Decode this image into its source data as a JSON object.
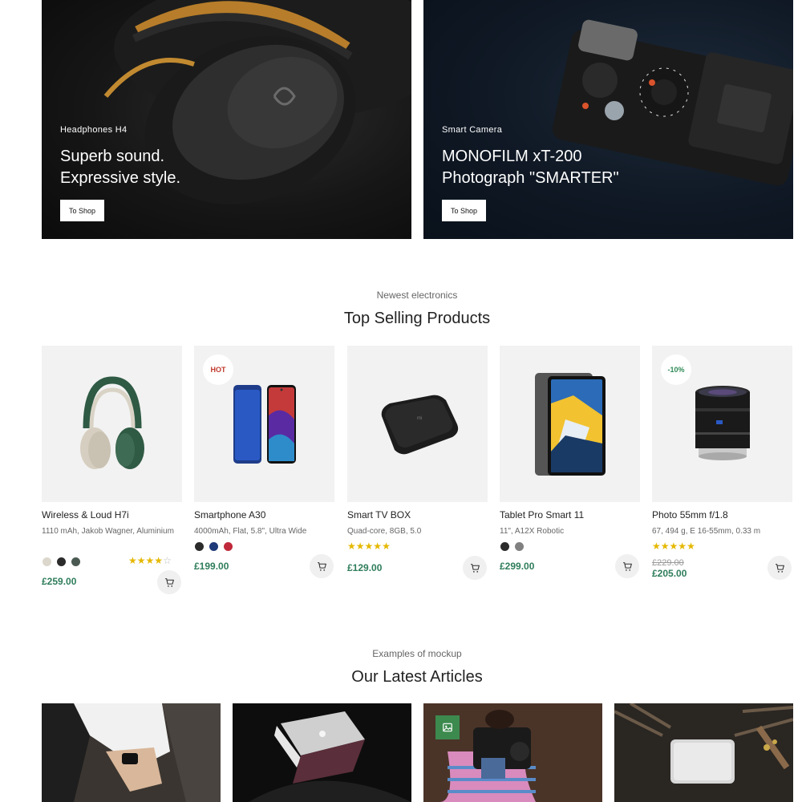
{
  "banners": [
    {
      "subtitle": "Headphones H4",
      "title_line1": "Superb sound.",
      "title_line2": "Expressive style.",
      "button": "To Shop"
    },
    {
      "subtitle": "Smart Camera",
      "title_line1": "MONOFILM xT-200",
      "title_line2": "Photograph \"SMARTER\"",
      "button": "To Shop"
    }
  ],
  "products_section": {
    "subtitle": "Newest electronics",
    "title": "Top Selling Products"
  },
  "products": [
    {
      "name": "Wireless & Loud H7i",
      "desc": "1110 mAh, Jakob Wagner, Aluminium",
      "price": "£259.00",
      "rating": 4,
      "colors": [
        "#dcd7cc",
        "#2b2b2b",
        "#4a5a52"
      ],
      "badge": ""
    },
    {
      "name": "Smartphone A30",
      "desc": "4000mAh, Flat, 5.8\", Ultra Wide",
      "price": "£199.00",
      "colors": [
        "#2b2b2b",
        "#1e3a78",
        "#c0293a"
      ],
      "badge": "HOT"
    },
    {
      "name": "Smart TV BOX",
      "desc": "Quad-core, 8GB, 5.0",
      "price": "£129.00",
      "rating": 5,
      "badge": ""
    },
    {
      "name": "Tablet Pro Smart 11",
      "desc": "11\", A12X Robotic",
      "price": "£299.00",
      "colors": [
        "#2b2b2b",
        "#808080"
      ],
      "badge": ""
    },
    {
      "name": "Photo 55mm f/1.8",
      "desc": "67, 494 g, E 16-55mm, 0.33 m",
      "old_price": "£229.00",
      "price": "£205.00",
      "rating": 5,
      "badge": "-10%"
    }
  ],
  "articles_section": {
    "subtitle": "Examples of mockup",
    "title": "Our Latest Articles"
  },
  "icons": {
    "cart": "shopping-cart-icon",
    "image": "image-icon",
    "star": "star-icon"
  },
  "colors": {
    "price_green": "#2e7d5b",
    "star_yellow": "#e5b800",
    "hot_red": "#c0392b",
    "tag_green": "#3d8a4e"
  }
}
